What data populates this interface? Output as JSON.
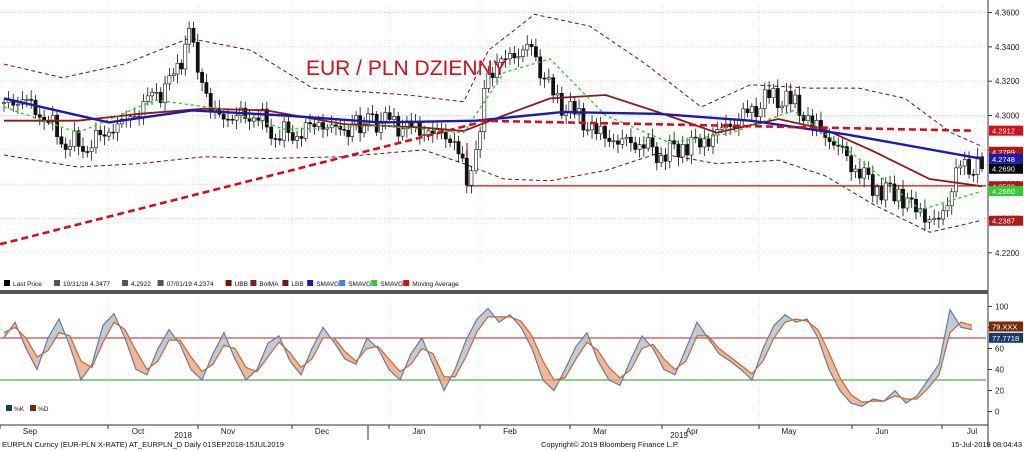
{
  "title": "EUR / PLN DZIENNY",
  "chart_data": [
    {
      "type": "candlestick",
      "panel": "price",
      "title": "EUR / PLN DZIENNY",
      "ylim": [
        4.21,
        4.365
      ],
      "y_ticks": [
        "4.3600",
        "4.3400",
        "4.3200",
        "4.3000",
        "4.2800",
        "4.2600",
        "4.2400",
        "4.2200"
      ],
      "x_ticks": [
        "Sep",
        "Oct",
        "Nov",
        "Dec",
        "Jan",
        "Feb",
        "Mar",
        "Apr",
        "May",
        "Jun",
        "Jul"
      ],
      "x_year_labels": [
        "2018",
        "2019"
      ],
      "legend": [
        {
          "label": "Last Price",
          "color": "#000000"
        },
        {
          "label": "10/31/18 4.3477",
          "color": "#555555"
        },
        {
          "label": "4.2922",
          "color": "#555555"
        },
        {
          "label": "07/01/19 4.2374",
          "color": "#555555"
        },
        {
          "label": "UBB",
          "color": "#7a1010"
        },
        {
          "label": "BolMA",
          "color": "#8b1a1a"
        },
        {
          "label": "LBB",
          "color": "#7a1010"
        },
        {
          "label": "SMAVG",
          "color": "#1a1ab0"
        },
        {
          "label": "SMAVG",
          "color": "#3a8ad0"
        },
        {
          "label": "SMAVG",
          "color": "#33cc33"
        },
        {
          "label": "Moving Average",
          "color": "#d0101a"
        }
      ],
      "axis_tags": [
        {
          "value": 4.2912,
          "label": "4.2912",
          "color": "#d0101a"
        },
        {
          "value": 4.2789,
          "label": "4.2789",
          "color": "#b01818"
        },
        {
          "value": 4.2748,
          "label": "4.2748",
          "color": "#1a1ab0"
        },
        {
          "value": 4.269,
          "label": "4.2690",
          "color": "#000000"
        },
        {
          "value": 4.2588,
          "label": "4.2588",
          "color": "#b01818"
        },
        {
          "value": 4.256,
          "label": "4.2560",
          "color": "#33cc33"
        },
        {
          "value": 4.2387,
          "label": "4.2387",
          "color": "#b01818"
        }
      ],
      "support_line": {
        "from_month": "Jan",
        "to_month": "Jul",
        "value": 4.259,
        "color": "#b01818"
      },
      "trend_line": {
        "start": [
          "Sep",
          4.225
        ],
        "end": [
          "Feb",
          4.296
        ],
        "color": "#d0101a"
      },
      "long_ma_line": {
        "start": [
          "Feb",
          4.297
        ],
        "end": [
          "Jul",
          4.2912
        ],
        "color": "#d0101a"
      },
      "close_path": [
        [
          "2018-09-01",
          4.305
        ],
        [
          "2018-09-07",
          4.31
        ],
        [
          "2018-09-14",
          4.3
        ],
        [
          "2018-09-21",
          4.285
        ],
        [
          "2018-09-28",
          4.283
        ],
        [
          "2018-10-05",
          4.292
        ],
        [
          "2018-10-12",
          4.298
        ],
        [
          "2018-10-19",
          4.31
        ],
        [
          "2018-10-26",
          4.32
        ],
        [
          "2018-10-31",
          4.3477
        ],
        [
          "2018-11-07",
          4.302
        ],
        [
          "2018-11-14",
          4.299
        ],
        [
          "2018-11-21",
          4.302
        ],
        [
          "2018-11-28",
          4.29
        ],
        [
          "2018-12-05",
          4.29
        ],
        [
          "2018-12-12",
          4.296
        ],
        [
          "2018-12-19",
          4.29
        ],
        [
          "2018-12-28",
          4.298
        ],
        [
          "2019-01-04",
          4.295
        ],
        [
          "2019-01-11",
          4.292
        ],
        [
          "2019-01-18",
          4.29
        ],
        [
          "2019-01-25",
          4.287
        ],
        [
          "2019-01-29",
          4.262
        ],
        [
          "2019-02-01",
          4.282
        ],
        [
          "2019-02-05",
          4.325
        ],
        [
          "2019-02-12",
          4.335
        ],
        [
          "2019-02-19",
          4.338
        ],
        [
          "2019-02-26",
          4.31
        ],
        [
          "2019-03-05",
          4.3
        ],
        [
          "2019-03-12",
          4.29
        ],
        [
          "2019-03-19",
          4.285
        ],
        [
          "2019-03-26",
          4.285
        ],
        [
          "2019-04-02",
          4.278
        ],
        [
          "2019-04-09",
          4.283
        ],
        [
          "2019-04-16",
          4.285
        ],
        [
          "2019-04-23",
          4.293
        ],
        [
          "2019-04-30",
          4.3
        ],
        [
          "2019-05-07",
          4.31
        ],
        [
          "2019-05-14",
          4.308
        ],
        [
          "2019-05-21",
          4.295
        ],
        [
          "2019-05-28",
          4.285
        ],
        [
          "2019-06-04",
          4.27
        ],
        [
          "2019-06-11",
          4.258
        ],
        [
          "2019-06-18",
          4.255
        ],
        [
          "2019-06-25",
          4.243
        ],
        [
          "2019-07-01",
          4.2374
        ],
        [
          "2019-07-08",
          4.27
        ],
        [
          "2019-07-15",
          4.269
        ]
      ],
      "bollinger_upper": [
        [
          "2018-09-01",
          4.33
        ],
        [
          "2018-09-20",
          4.322
        ],
        [
          "2018-10-10",
          4.33
        ],
        [
          "2018-10-31",
          4.345
        ],
        [
          "2018-11-20",
          4.338
        ],
        [
          "2018-12-10",
          4.316
        ],
        [
          "2019-01-10",
          4.312
        ],
        [
          "2019-01-28",
          4.308
        ],
        [
          "2019-02-05",
          4.338
        ],
        [
          "2019-02-20",
          4.359
        ],
        [
          "2019-03-10",
          4.352
        ],
        [
          "2019-03-28",
          4.33
        ],
        [
          "2019-04-15",
          4.305
        ],
        [
          "2019-05-01",
          4.318
        ],
        [
          "2019-05-20",
          4.316
        ],
        [
          "2019-06-05",
          4.316
        ],
        [
          "2019-06-20",
          4.31
        ],
        [
          "2019-07-05",
          4.29
        ],
        [
          "2019-07-15",
          4.282
        ]
      ],
      "bollinger_lower": [
        [
          "2018-09-01",
          4.277
        ],
        [
          "2018-09-25",
          4.27
        ],
        [
          "2018-10-15",
          4.272
        ],
        [
          "2018-11-05",
          4.276
        ],
        [
          "2018-11-25",
          4.275
        ],
        [
          "2018-12-20",
          4.276
        ],
        [
          "2019-01-15",
          4.28
        ],
        [
          "2019-01-28",
          4.272
        ],
        [
          "2019-02-10",
          4.263
        ],
        [
          "2019-02-25",
          4.262
        ],
        [
          "2019-03-15",
          4.268
        ],
        [
          "2019-04-01",
          4.278
        ],
        [
          "2019-04-20",
          4.272
        ],
        [
          "2019-05-10",
          4.274
        ],
        [
          "2019-05-25",
          4.265
        ],
        [
          "2019-06-10",
          4.248
        ],
        [
          "2019-06-28",
          4.232
        ],
        [
          "2019-07-08",
          4.236
        ],
        [
          "2019-07-15",
          4.239
        ]
      ],
      "bollinger_mid": [
        [
          "2018-09-01",
          4.297
        ],
        [
          "2018-09-25",
          4.297
        ],
        [
          "2018-10-15",
          4.301
        ],
        [
          "2018-11-05",
          4.304
        ],
        [
          "2018-11-25",
          4.303
        ],
        [
          "2018-12-20",
          4.295
        ],
        [
          "2019-01-15",
          4.293
        ],
        [
          "2019-01-28",
          4.291
        ],
        [
          "2019-02-10",
          4.3
        ],
        [
          "2019-02-25",
          4.31
        ],
        [
          "2019-03-15",
          4.312
        ],
        [
          "2019-04-01",
          4.302
        ],
        [
          "2019-04-20",
          4.29
        ],
        [
          "2019-05-10",
          4.298
        ],
        [
          "2019-05-25",
          4.292
        ],
        [
          "2019-06-10",
          4.279
        ],
        [
          "2019-06-28",
          4.263
        ],
        [
          "2019-07-15",
          4.2588
        ]
      ],
      "sma_blue": [
        [
          "2018-09-01",
          4.31
        ],
        [
          "2018-10-05",
          4.296
        ],
        [
          "2018-11-01",
          4.303
        ],
        [
          "2018-12-01",
          4.3
        ],
        [
          "2019-01-01",
          4.296
        ],
        [
          "2019-02-01",
          4.297
        ],
        [
          "2019-03-01",
          4.302
        ],
        [
          "2019-04-01",
          4.301
        ],
        [
          "2019-05-01",
          4.297
        ],
        [
          "2019-06-01",
          4.289
        ],
        [
          "2019-07-15",
          4.2748
        ]
      ],
      "sma_green": [
        [
          "2018-09-01",
          4.305
        ],
        [
          "2018-09-25",
          4.29
        ],
        [
          "2018-10-20",
          4.309
        ],
        [
          "2018-11-10",
          4.304
        ],
        [
          "2018-12-01",
          4.292
        ],
        [
          "2019-01-01",
          4.294
        ],
        [
          "2019-01-28",
          4.29
        ],
        [
          "2019-02-10",
          4.325
        ],
        [
          "2019-02-25",
          4.333
        ],
        [
          "2019-03-15",
          4.3
        ],
        [
          "2019-04-05",
          4.284
        ],
        [
          "2019-04-25",
          4.29
        ],
        [
          "2019-05-15",
          4.303
        ],
        [
          "2019-06-05",
          4.275
        ],
        [
          "2019-06-25",
          4.245
        ],
        [
          "2019-07-15",
          4.256
        ]
      ]
    },
    {
      "type": "line",
      "panel": "stochastic",
      "ylim": [
        -8,
        108
      ],
      "y_ticks": [
        "100",
        "80",
        "60",
        "40",
        "20",
        "0"
      ],
      "reference_lines": [
        {
          "value": 70,
          "color": "#b02020"
        },
        {
          "value": 30,
          "color": "#2a9a2a"
        }
      ],
      "last_value_tags": [
        {
          "value": 79,
          "label": "79.XXX",
          "color": "#7a2a0a"
        },
        {
          "value": 77.7718,
          "label": "77.7718",
          "color": "#1a3a6a"
        }
      ],
      "legend": [
        {
          "label": "%K",
          "color": "#1a3a6a"
        },
        {
          "label": "%D",
          "color": "#7a2a0a"
        }
      ],
      "series": [
        {
          "name": "%K",
          "color": "#6b7b95",
          "values": [
            70,
            85,
            60,
            40,
            70,
            88,
            62,
            30,
            45,
            82,
            93,
            70,
            40,
            35,
            60,
            78,
            64,
            40,
            30,
            55,
            75,
            50,
            30,
            40,
            65,
            72,
            48,
            35,
            60,
            80,
            66,
            50,
            45,
            70,
            60,
            40,
            30,
            55,
            70,
            45,
            20,
            40,
            68,
            88,
            98,
            85,
            92,
            80,
            60,
            30,
            20,
            40,
            62,
            75,
            48,
            30,
            25,
            50,
            72,
            60,
            40,
            35,
            60,
            85,
            70,
            55,
            48,
            40,
            30,
            60,
            82,
            92,
            85,
            88,
            70,
            40,
            20,
            8,
            5,
            12,
            10,
            20,
            8,
            15,
            30,
            45,
            97,
            80,
            78
          ]
        },
        {
          "name": "%D",
          "color": "#c5683a",
          "values": [
            75,
            80,
            70,
            52,
            58,
            75,
            72,
            48,
            42,
            66,
            85,
            78,
            58,
            40,
            48,
            68,
            68,
            52,
            38,
            45,
            63,
            60,
            42,
            38,
            52,
            66,
            56,
            42,
            50,
            70,
            70,
            57,
            48,
            60,
            62,
            50,
            38,
            45,
            60,
            55,
            33,
            33,
            52,
            76,
            90,
            90,
            90,
            86,
            72,
            48,
            30,
            32,
            50,
            66,
            58,
            42,
            32,
            40,
            60,
            64,
            50,
            40,
            48,
            72,
            72,
            60,
            52,
            44,
            36,
            48,
            70,
            85,
            88,
            86,
            78,
            56,
            32,
            16,
            9,
            10,
            10,
            15,
            12,
            12,
            22,
            35,
            75,
            85,
            82
          ]
        }
      ]
    }
  ],
  "footer": {
    "left": "EURPLN Curncy (EUR-PLN X-RATE) AT_EURPLN_D  Daily 01SEP2018-15JUL2019",
    "center": "Copyright© 2019 Bloomberg Finance L.P.",
    "right": "15-Jul-2019 08:04:43"
  }
}
